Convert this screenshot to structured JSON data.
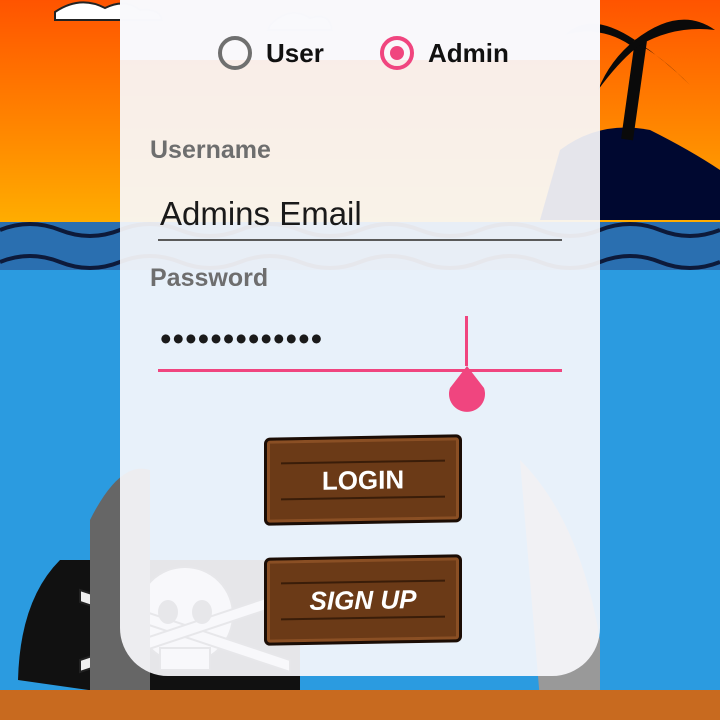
{
  "role_selector": {
    "user_label": "User",
    "admin_label": "Admin",
    "selected": "Admin"
  },
  "username": {
    "label": "Username",
    "value": "Admins Email"
  },
  "password": {
    "label": "Password",
    "masked_value": "•••••••••••••"
  },
  "buttons": {
    "login_label": "LOGIN",
    "signup_label": "SIGN UP"
  },
  "colors": {
    "accent": "#f0457f",
    "sky_top": "#ff6a00",
    "sea": "#2b9be0",
    "plank": "#6b3a17"
  }
}
